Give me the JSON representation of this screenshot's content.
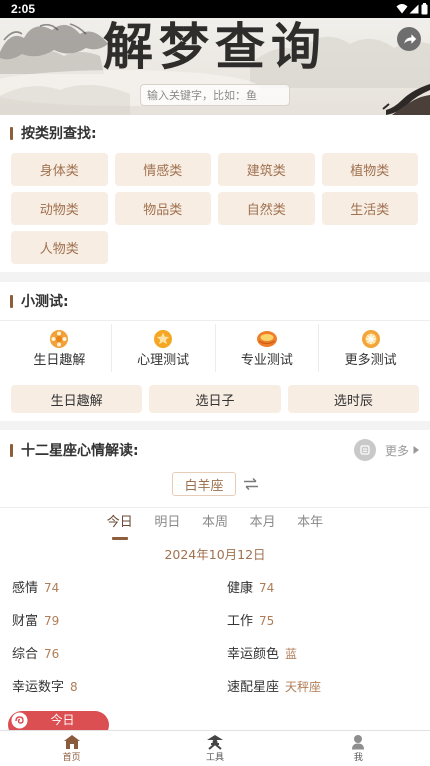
{
  "status_bar": {
    "time": "2:05",
    "icons": [
      "wifi-icon",
      "signal-icon",
      "battery-icon"
    ]
  },
  "header": {
    "title": "解梦查询",
    "share_icon": "share-icon",
    "search": {
      "placeholder": "输入关键字，比如：鱼",
      "value": ""
    }
  },
  "categories": {
    "title": "按类别查找:",
    "items": [
      {
        "label": "身体类"
      },
      {
        "label": "情感类"
      },
      {
        "label": "建筑类"
      },
      {
        "label": "植物类"
      },
      {
        "label": "动物类"
      },
      {
        "label": "物品类"
      },
      {
        "label": "自然类"
      },
      {
        "label": "生活类"
      },
      {
        "label": "人物类"
      }
    ]
  },
  "tests": {
    "title": "小测试:",
    "items": [
      {
        "label": "生日趣解",
        "icon": "birthday-flower-icon"
      },
      {
        "label": "心理测试",
        "icon": "psychology-badge-icon"
      },
      {
        "label": "专业测试",
        "icon": "professional-lens-icon"
      },
      {
        "label": "更多测试",
        "icon": "more-tests-icon"
      }
    ],
    "buttons": [
      {
        "label": "生日趣解"
      },
      {
        "label": "选日子"
      },
      {
        "label": "选时辰"
      }
    ]
  },
  "horoscope": {
    "title": "十二星座心情解读:",
    "more_label": "更多",
    "more_icon": "more-circle-icon",
    "sign": "白羊座",
    "swap_icon": "swap-icon",
    "tabs": [
      {
        "label": "今日",
        "active": true
      },
      {
        "label": "明日",
        "active": false
      },
      {
        "label": "本周",
        "active": false
      },
      {
        "label": "本月",
        "active": false
      },
      {
        "label": "本年",
        "active": false
      }
    ],
    "date": "2024年10月12日",
    "stats": [
      {
        "label": "感情",
        "value": 74
      },
      {
        "label": "健康",
        "value": 74
      },
      {
        "label": "财富",
        "value": 79
      },
      {
        "label": "工作",
        "value": 75
      },
      {
        "label": "综合",
        "value": 76
      },
      {
        "label": "幸运颜色",
        "value": "蓝"
      },
      {
        "label": "幸运数字",
        "value": 8
      },
      {
        "label": "速配星座",
        "value": "天秤座"
      }
    ]
  },
  "floating_badge": {
    "label": "今日",
    "icon": "swirl-icon"
  },
  "bottom_nav": {
    "items": [
      {
        "label": "首页",
        "icon": "home-icon",
        "active": true
      },
      {
        "label": "工具",
        "icon": "tools-icon",
        "active": false
      },
      {
        "label": "我",
        "icon": "profile-icon",
        "active": false
      }
    ]
  },
  "colors": {
    "accent": "#a0714f",
    "category_bg": "#f7ede3",
    "value": "#b07d57",
    "badge_red": "#db4f52",
    "separator": "#f3f3f3",
    "bar": "#8d5d3c"
  }
}
